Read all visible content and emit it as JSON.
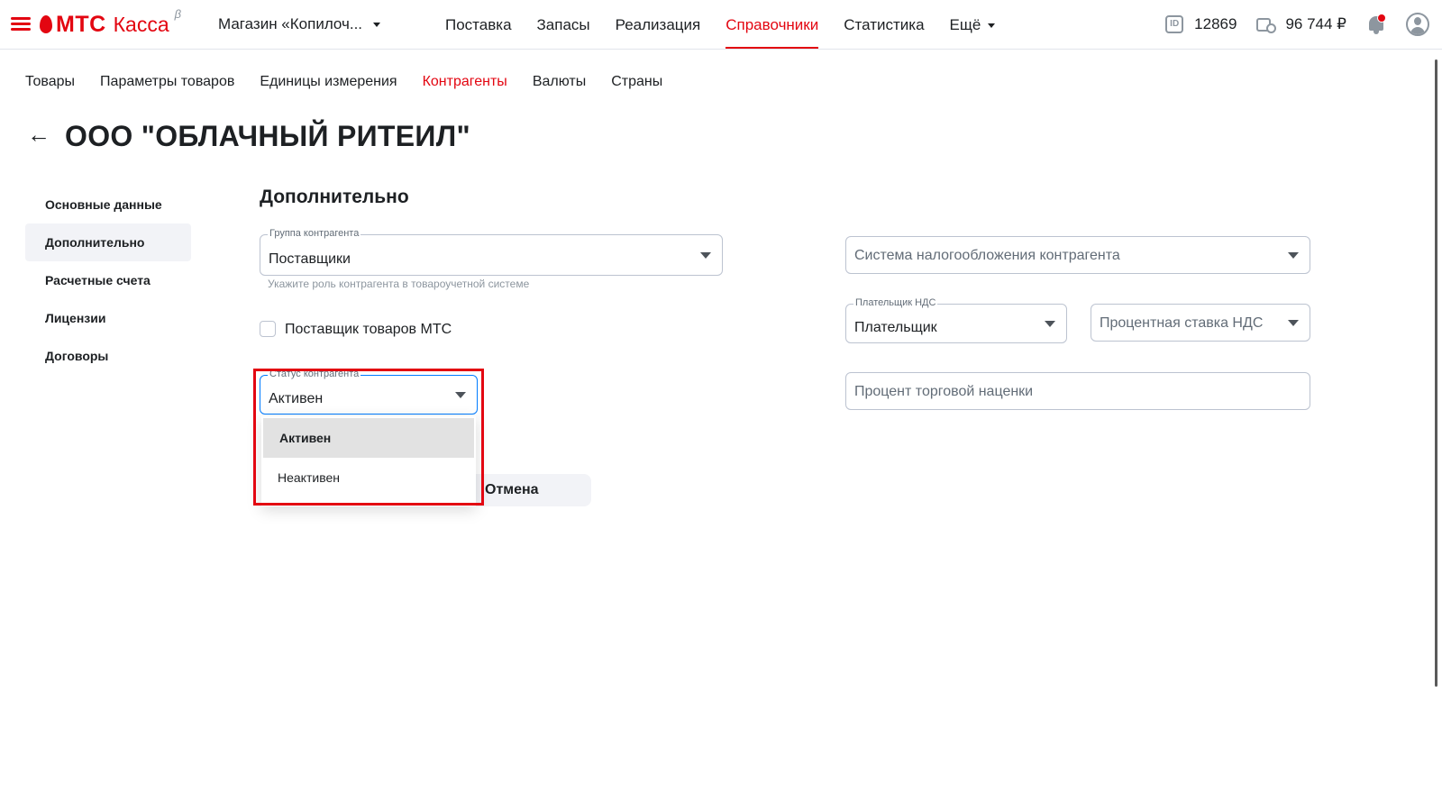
{
  "header": {
    "logo_mts": "МТС",
    "logo_kassa": "Касса",
    "logo_beta": "β",
    "store_name": "Магазин «Копилоч...",
    "nav": [
      {
        "label": "Поставка"
      },
      {
        "label": "Запасы"
      },
      {
        "label": "Реализация"
      },
      {
        "label": "Справочники"
      },
      {
        "label": "Статистика"
      },
      {
        "label": "Ещё"
      }
    ],
    "id_icon_text": "ID",
    "account_id": "12869",
    "balance": "96 744 ₽"
  },
  "subnav": [
    {
      "label": "Товары"
    },
    {
      "label": "Параметры товаров"
    },
    {
      "label": "Единицы измерения"
    },
    {
      "label": "Контрагенты"
    },
    {
      "label": "Валюты"
    },
    {
      "label": "Страны"
    }
  ],
  "back_arrow": "←",
  "page_title": "ООО \"ОБЛАЧНЫЙ РИТЕИЛ\"",
  "side_menu": [
    {
      "label": "Основные данные"
    },
    {
      "label": "Дополнительно"
    },
    {
      "label": "Расчетные счета"
    },
    {
      "label": "Лицензии"
    },
    {
      "label": "Договоры"
    }
  ],
  "section_title": "Дополнительно",
  "form": {
    "group": {
      "label": "Группа контрагента",
      "value": "Поставщики",
      "hint": "Укажите роль контрагента в товароучетной системе"
    },
    "mts_supplier_label": "Поставщик товаров МТС",
    "status": {
      "label": "Статус контрагента",
      "value": "Активен",
      "options": [
        "Активен",
        "Неактивен"
      ]
    },
    "tax_system_placeholder": "Система налогообложения контрагента",
    "vat_payer": {
      "label": "Плательщик НДС",
      "value": "Плательщик"
    },
    "vat_rate_placeholder": "Процентная ставка НДС",
    "markup_placeholder": "Процент торговой наценки"
  },
  "cancel_button": "Отмена",
  "colors": {
    "accent": "#e30611",
    "focus": "#007cff",
    "text": "#1d2023"
  }
}
